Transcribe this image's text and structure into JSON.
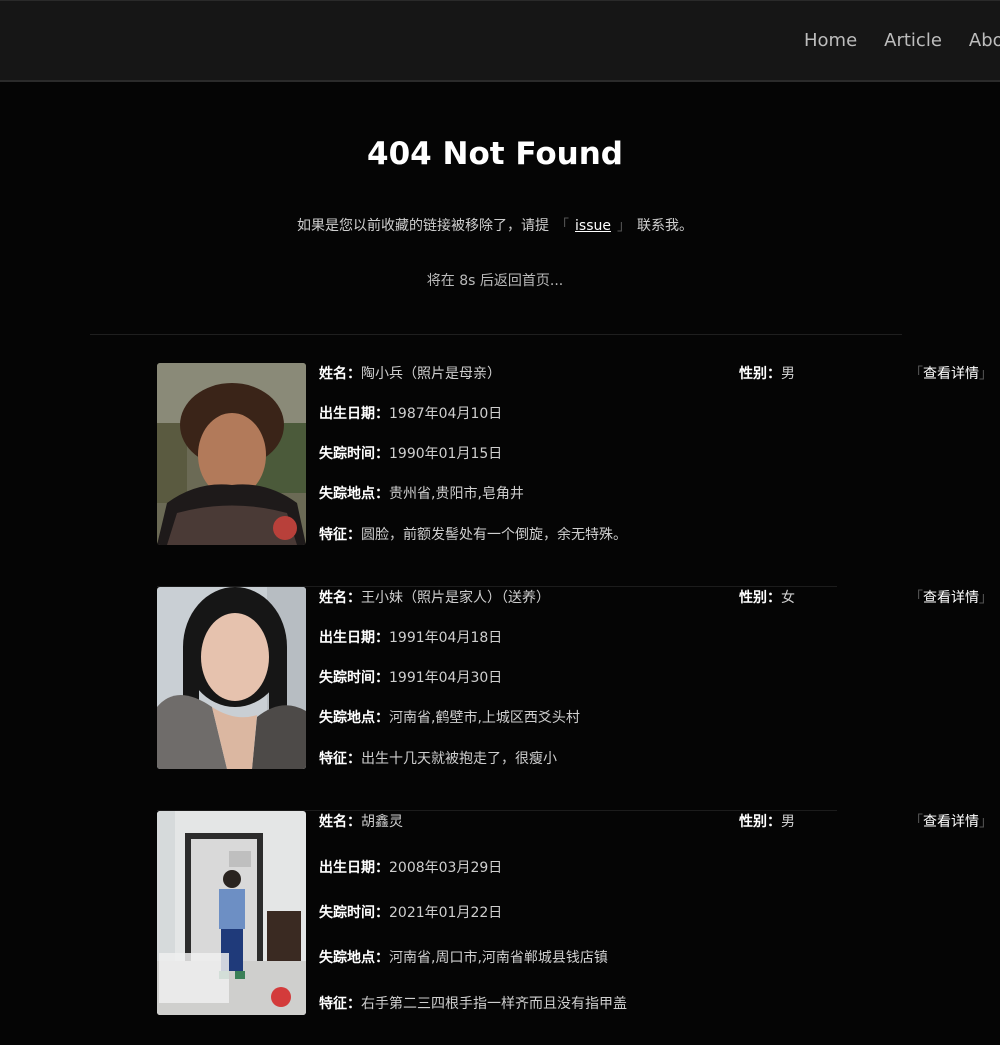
{
  "nav": {
    "items": [
      "Home",
      "Article",
      "About"
    ]
  },
  "page": {
    "title": "404 Not Found",
    "notice_before": "如果是您以前收藏的链接被移除了，请提",
    "notice_link": "issue",
    "notice_after": "联系我。",
    "bracket_open": "「",
    "bracket_close": "」",
    "countdown": "将在 8s 后返回首页..."
  },
  "labels": {
    "name": "姓名：",
    "gender": "性别：",
    "birth": "出生日期：",
    "missing_time": "失踪时间：",
    "missing_place": "失踪地点：",
    "feature": "特征：",
    "detail": "查看详情"
  },
  "people": [
    {
      "name": "陶小兵（照片是母亲）",
      "gender": "男",
      "birth": "1987年04月10日",
      "missing_time": "1990年01月15日",
      "missing_place": "贵州省,贵阳市,皂角井",
      "feature": "圆脸，前额发髻处有一个倒旋，余无特殊。"
    },
    {
      "name": "王小妹（照片是家人）（送养）",
      "gender": "女",
      "birth": "1991年04月18日",
      "missing_time": "1991年04月30日",
      "missing_place": "河南省,鹤壁市,上城区西爻头村",
      "feature": "出生十几天就被抱走了，很瘦小"
    },
    {
      "name": "胡鑫灵",
      "gender": "男",
      "birth": "2008年03月29日",
      "missing_time": "2021年01月22日",
      "missing_place": "河南省,周口市,河南省郸城县钱店镇",
      "feature": "右手第二三四根手指一样齐而且没有指甲盖"
    }
  ],
  "colors": {
    "background": "#050505",
    "header": "#161616",
    "text": "#cfcfcf",
    "heading": "#ffffff"
  }
}
